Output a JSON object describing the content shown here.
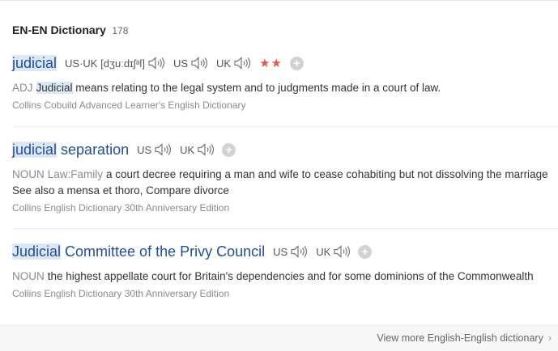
{
  "section": {
    "title": "EN-EN Dictionary",
    "count": "178"
  },
  "entries": [
    {
      "word_hl": "judicial",
      "word_rest": "",
      "phonetic": "US·UK [dʒuːdɪʃᵊl]",
      "us": "US",
      "uk": "UK",
      "stars": "★★",
      "pos": "ADJ",
      "def_hl": "Judicial",
      "def_rest": " means relating to the legal system and to judgments made in a court of law.",
      "source": "Collins Cobuild Advanced Learner's English Dictionary"
    },
    {
      "word_hl": "judicial",
      "word_rest": " separation",
      "us": "US",
      "uk": "UK",
      "pos": "NOUN",
      "subject": "Law:Family",
      "def_rest": "a court decree requiring a man and wife to cease cohabiting but not dissolving the marriage See also a mensa et thoro, Compare divorce",
      "source": "Collins English Dictionary 30th Anniversary Edition"
    },
    {
      "word_hl": "Judicial",
      "word_rest": " Committee of the Privy Council",
      "us": "US",
      "uk": "UK",
      "pos": "NOUN",
      "def_rest": "the highest appellate court for Britain's dependencies and for some dominions of the Commonwealth",
      "source": "Collins English Dictionary 30th Anniversary Edition"
    }
  ],
  "footer": {
    "more_label": "View more English-English dictionary"
  },
  "icons": {
    "speaker": "speaker-icon",
    "add": "plus-icon",
    "chevron": "chevron-right-icon"
  },
  "colors": {
    "headword": "#1f4d9e",
    "highlight": "#dce8f6",
    "stars": "#e05a4a"
  }
}
